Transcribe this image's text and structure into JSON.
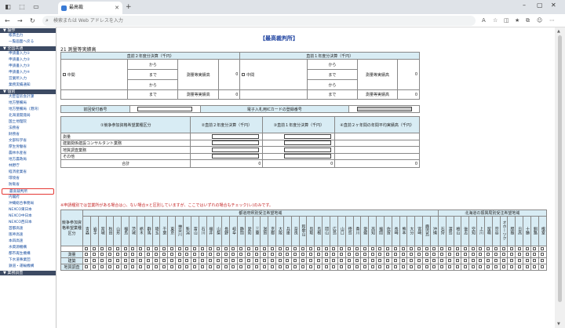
{
  "browser": {
    "tab_title": "最高裁",
    "address_placeholder": "検索または Web アドレスを入力"
  },
  "sidebar": {
    "sections": [
      {
        "title": "▼ 操作",
        "items": [
          "帳票出力",
          "一覧画面へ戻る"
        ]
      },
      {
        "title": "▼ 全国共通",
        "items": [
          "申請書入力①",
          "申請書入力②",
          "申請書入力③",
          "申請書入力④",
          "営業所入力",
          "業務実績通知"
        ]
      },
      {
        "title": "▼ 個別",
        "items": [
          "大臣官房会計課",
          "地方整備局",
          "地方整備局（港湾）",
          "北海道開発局",
          "国土地理院",
          "法務省",
          "財務省",
          "文部科学省",
          "厚生労働省",
          "農林水産省",
          "地方農政局",
          "林野庁",
          "経済産業省",
          "環境省",
          "防衛省",
          "最高裁判所",
          "内閣府",
          "沖縄総合事務局",
          "NEXCO東日本",
          "NEXCO中日本",
          "NEXCO西日本",
          "首都高速",
          "阪神高速",
          "本四高速",
          "水資源機構",
          "都市再生機構",
          "下水道事業団",
          "鉄道・運輸機構"
        ]
      },
      {
        "title": "▼ 業務調査",
        "items": []
      }
    ],
    "highlighted": "最高裁判所"
  },
  "page": {
    "title": "【最高裁判所】",
    "section": "21 測量等実績高",
    "prev2_header": "直前２年度分決算（千円）",
    "prev1_header": "直前１年度分決算（千円）",
    "middle": "中間",
    "from": "から",
    "to": "まで",
    "perf": "測量等実績高",
    "zero": "0",
    "prev_no": "前回受付番号",
    "ic_card": "電子入札用ICカードの登録番号",
    "comp_type": "①競争参加資格希望業種区分",
    "col2": "②直前２年度分決算（千円）",
    "col3": "③直前１年度分決算（千円）",
    "col4": "④直前２ヶ年間の年間平均実績高（千円）",
    "rows": [
      "測量",
      "建築関係建設コンサルタント業務",
      "地質調査業務",
      "その他"
    ],
    "total": "合計",
    "note": "※申請種別では営業所がある場合は○、ない場合×と区別していますが、ここではいずれの場合もチェック(レ)のみです。",
    "pref_header": "都道府県別受注希望地域",
    "hokkaido_header": "北海道の振興局別受注希望地域",
    "row_label": "競争参加資格希望業種区分",
    "types": [
      "測量",
      "建築",
      "地質調査"
    ],
    "prefs": [
      "青森",
      "岩手",
      "宮城",
      "秋田",
      "山形",
      "福島",
      "茨城",
      "栃木",
      "群馬",
      "埼玉",
      "千葉",
      "東京",
      "神奈川",
      "新潟",
      "富山",
      "石川",
      "福井",
      "山梨",
      "長野",
      "岐阜",
      "静岡",
      "愛知",
      "三重",
      "滋賀",
      "京都",
      "大阪",
      "兵庫",
      "奈良",
      "和歌山",
      "鳥取",
      "島根",
      "岡山",
      "広島",
      "山口",
      "徳島",
      "香川",
      "愛媛",
      "高知",
      "福岡",
      "佐賀",
      "長崎",
      "熊本",
      "大分",
      "宮崎",
      "鹿児島",
      "沖縄"
    ],
    "hokkaido": [
      "石狩",
      "渡島",
      "檜山",
      "後志",
      "空知",
      "上川",
      "留萌",
      "宗谷",
      "オホーツク",
      "胆振",
      "日高",
      "十勝",
      "釧路",
      "根室"
    ]
  }
}
